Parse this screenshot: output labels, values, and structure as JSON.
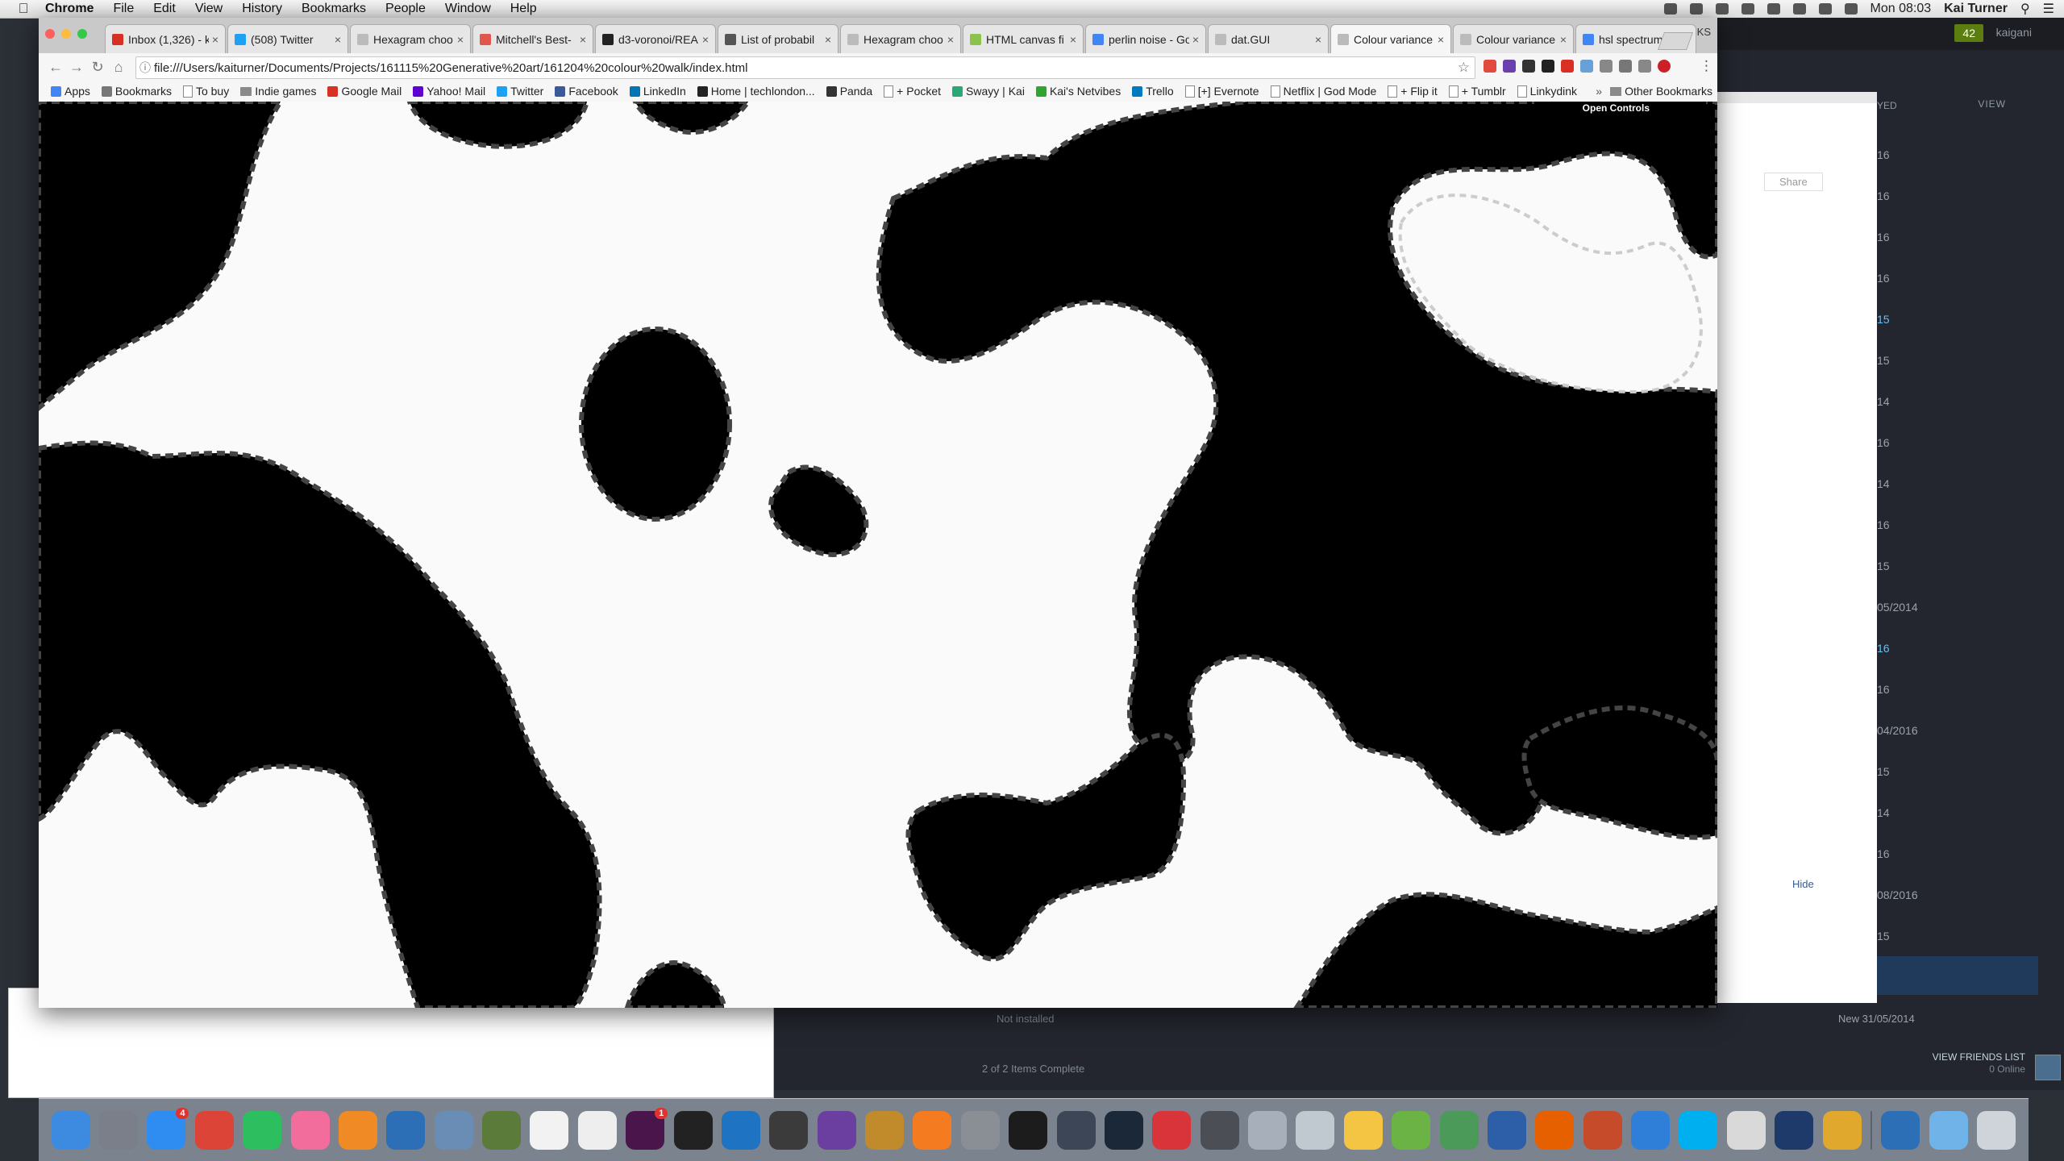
{
  "menubar": {
    "app_name": "Chrome",
    "items": [
      "File",
      "Edit",
      "View",
      "History",
      "Bookmarks",
      "People",
      "Window",
      "Help"
    ],
    "clock": "Mon 08:03",
    "user": "Kai Turner"
  },
  "chrome": {
    "tabs": [
      {
        "title": "Inbox (1,326) - k",
        "favicon_color": "#d93025",
        "active": false
      },
      {
        "title": "(508) Twitter",
        "favicon_color": "#1da1f2",
        "active": false
      },
      {
        "title": "Hexagram choo",
        "favicon_color": "#bbbbbb",
        "active": false
      },
      {
        "title": "Mitchell's Best-",
        "favicon_color": "#e2574c",
        "active": false
      },
      {
        "title": "d3-voronoi/REA",
        "favicon_color": "#222222",
        "active": false
      },
      {
        "title": "List of probabil",
        "favicon_color": "#555555",
        "active": false
      },
      {
        "title": "Hexagram choo",
        "favicon_color": "#bbbbbb",
        "active": false
      },
      {
        "title": "HTML canvas fi",
        "favicon_color": "#8bc34a",
        "active": false
      },
      {
        "title": "perlin noise - Go",
        "favicon_color": "#4285f4",
        "active": false
      },
      {
        "title": "dat.GUI",
        "favicon_color": "#bbbbbb",
        "active": false
      },
      {
        "title": "Colour variance",
        "favicon_color": "#bbbbbb",
        "active": true
      },
      {
        "title": "Colour variance",
        "favicon_color": "#bbbbbb",
        "active": false
      },
      {
        "title": "hsl spectrum - G",
        "favicon_color": "#4285f4",
        "active": false
      }
    ],
    "profile": "KS",
    "url": "file:///Users/kaiturner/Documents/Projects/161115%20Generative%20art/161204%20colour%20walk/index.html",
    "bookmarks": [
      {
        "label": "Apps",
        "icon": "apps-grid"
      },
      {
        "label": "Bookmarks",
        "icon": "star"
      },
      {
        "label": "To buy",
        "icon": "page"
      },
      {
        "label": "Indie games",
        "icon": "folder"
      },
      {
        "label": "Google Mail",
        "icon": "gmail"
      },
      {
        "label": "Yahoo! Mail",
        "icon": "yahoo"
      },
      {
        "label": "Twitter",
        "icon": "twitter"
      },
      {
        "label": "Facebook",
        "icon": "facebook"
      },
      {
        "label": "LinkedIn",
        "icon": "linkedin"
      },
      {
        "label": "Home | techlondon...",
        "icon": "techlondon"
      },
      {
        "label": "Panda",
        "icon": "panda"
      },
      {
        "label": "+ Pocket",
        "icon": "page"
      },
      {
        "label": "Swayy | Kai",
        "icon": "swayy"
      },
      {
        "label": "Kai's Netvibes",
        "icon": "netvibes"
      },
      {
        "label": "Trello",
        "icon": "trello"
      },
      {
        "label": "[+] Evernote",
        "icon": "page"
      },
      {
        "label": "Netflix | God Mode",
        "icon": "page"
      },
      {
        "label": "+ Flip it",
        "icon": "page"
      },
      {
        "label": "+ Tumblr",
        "icon": "page"
      },
      {
        "label": "Linkydink",
        "icon": "page"
      }
    ],
    "other_bookmarks": "Other Bookmarks",
    "open_controls": "Open Controls"
  },
  "steam": {
    "badge": "42",
    "username": "kaigani",
    "view_label": "VIEW",
    "col_header": "YED",
    "side_values": [
      "16",
      "16",
      "16",
      "16",
      "15",
      "15",
      "14",
      "16",
      "14",
      "16",
      "15",
      "05/2014",
      "16",
      "16",
      "04/2016",
      "15",
      "14",
      "16",
      "08/2016",
      "15"
    ],
    "share": "Share",
    "hide": "Hide",
    "not_installed": "Not installed",
    "new_date": "New  31/05/2014",
    "items_complete": "2 of 2 Items Complete",
    "view_friends": "VIEW FRIENDS LIST",
    "online": "0 Online"
  },
  "dock": {
    "icons": [
      {
        "name": "finder",
        "color": "#3d8be0"
      },
      {
        "name": "launchpad",
        "color": "#7a7f8a"
      },
      {
        "name": "app-store",
        "color": "#2f8cf0",
        "badge": "4"
      },
      {
        "name": "chrome",
        "color": "#db4437"
      },
      {
        "name": "evernote",
        "color": "#2dbe60"
      },
      {
        "name": "itunes",
        "color": "#f26d9b"
      },
      {
        "name": "ibooks",
        "color": "#f08a24"
      },
      {
        "name": "1password",
        "color": "#2c6fb7"
      },
      {
        "name": "preview",
        "color": "#6a8db6"
      },
      {
        "name": "automator",
        "color": "#5b7b3a"
      },
      {
        "name": "calendar",
        "color": "#f2f2f2"
      },
      {
        "name": "textedit",
        "color": "#eeeeee"
      },
      {
        "name": "slack",
        "color": "#4a154b",
        "badge": "1"
      },
      {
        "name": "terminal",
        "color": "#222222"
      },
      {
        "name": "vscode",
        "color": "#1e73c2"
      },
      {
        "name": "sublime-text",
        "color": "#3b3b3b"
      },
      {
        "name": "imovie",
        "color": "#6b3fa0"
      },
      {
        "name": "scrivener",
        "color": "#c18a2a"
      },
      {
        "name": "vlc",
        "color": "#f47b20"
      },
      {
        "name": "system-preferences",
        "color": "#8a8f96"
      },
      {
        "name": "activity-monitor",
        "color": "#1c1c1c"
      },
      {
        "name": "atom",
        "color": "#3c4656"
      },
      {
        "name": "steam",
        "color": "#1b2838"
      },
      {
        "name": "flashcards",
        "color": "#d8343a"
      },
      {
        "name": "elite-dangerous",
        "color": "#4b4f55"
      },
      {
        "name": "keyboard",
        "color": "#a7b0ba"
      },
      {
        "name": "photo-browser",
        "color": "#c0c8d0"
      },
      {
        "name": "photos",
        "color": "#f4c542"
      },
      {
        "name": "android-studio",
        "color": "#6ab344"
      },
      {
        "name": "globe",
        "color": "#4c9a5a"
      },
      {
        "name": "transmit",
        "color": "#2d5ea8"
      },
      {
        "name": "firefox",
        "color": "#e66000"
      },
      {
        "name": "compass",
        "color": "#c64b2b"
      },
      {
        "name": "keynote",
        "color": "#2f7fd8"
      },
      {
        "name": "skype",
        "color": "#00aff0"
      },
      {
        "name": "recorder",
        "color": "#d9d9d9"
      },
      {
        "name": "quicktime",
        "color": "#1d3a6a"
      },
      {
        "name": "pineapple",
        "color": "#e0a92e"
      },
      {
        "name": "spacer",
        "color": "transparent"
      },
      {
        "name": "1password-mini",
        "color": "#2c6fb7"
      },
      {
        "name": "downloads-folder",
        "color": "#6fb3e8"
      },
      {
        "name": "trash",
        "color": "#cfd4da"
      }
    ]
  }
}
